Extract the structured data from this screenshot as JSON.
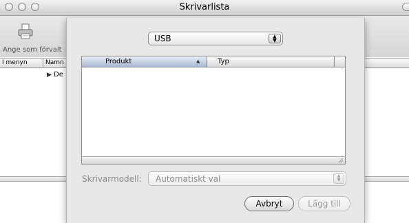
{
  "window": {
    "title": "Skrivarlista"
  },
  "toolbar": {
    "set_default_label": "Ange som förvalt",
    "set_default_icon": "printer-icon"
  },
  "list": {
    "columns": [
      "I menyn",
      "Namn"
    ],
    "rows": [
      {
        "disclosure": "▶",
        "name": "De"
      }
    ]
  },
  "sheet": {
    "connection_popup": {
      "value": "USB"
    },
    "table": {
      "columns": [
        "Produkt",
        "Typ"
      ],
      "sort_indicator": "▲",
      "rows": []
    },
    "model_label": "Skrivarmodell:",
    "model_popup": {
      "value": "Automatiskt val"
    },
    "cancel_button": "Avbryt",
    "add_button": "Lägg till"
  },
  "colors": {
    "sheet_bg": "#e8e8e8",
    "selected_header": "#a9b8d1",
    "disabled_text": "#8a8a8a"
  }
}
